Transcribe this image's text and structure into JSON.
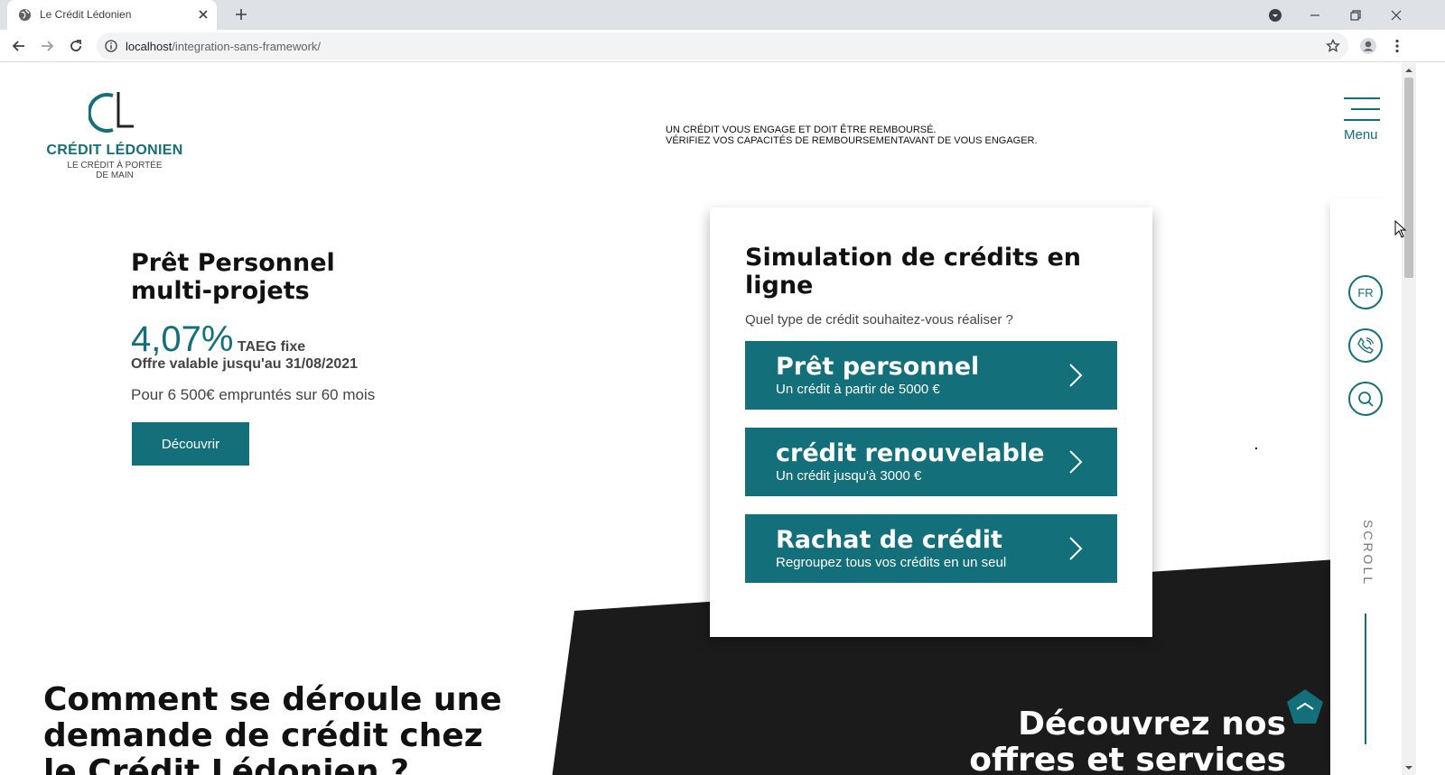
{
  "browser": {
    "tab_title": "Le Crédit Lédonien",
    "url_host": "localhost",
    "url_path": "/integration-sans-framework/"
  },
  "header": {
    "logo_name": "CRÉDIT LÉDONIEN",
    "logo_tagline_1": "LE CRÉDIT À PORTÉE",
    "logo_tagline_2": "DE MAIN",
    "legal_line_1": "UN CRÉDIT VOUS ENGAGE ET DOIT ÊTRE REMBOURSÉ.",
    "legal_line_2": "VÉRIFIEZ VOS CAPACITÉS DE REMBOURSEMENTAVANT DE VOUS ENGAGER.",
    "menu_label": "Menu"
  },
  "hero": {
    "title": "Prêt Personnel multi-projets",
    "rate": "4,07%",
    "rate_suffix": "TAEG fixe",
    "offer_valid": "Offre valable jusqu'au 31/08/2021",
    "offer_detail": "Pour 6 500€ empruntés sur 60 mois",
    "button": "Découvrir"
  },
  "simulator": {
    "title": "Simulation de crédits en ligne",
    "question": "Quel type de crédit souhaitez-vous réaliser ?",
    "options": [
      {
        "title": "Prêt personnel",
        "subtitle": "Un crédit à partir de 5000 €"
      },
      {
        "title": "crédit renouvelable",
        "subtitle": "Un crédit jusqu'à 3000 €"
      },
      {
        "title": "Rachat de crédit",
        "subtitle": "Regroupez tous vos crédits en un seul"
      }
    ]
  },
  "side_rail": {
    "language": "FR",
    "scroll_label": "SCROLL"
  },
  "sections": {
    "process_title": "Comment se déroule une demande de crédit chez le Crédit Lédonien ?",
    "offers_title": "Découvrez nos offres et services"
  },
  "colors": {
    "brand": "#136f7a",
    "dark": "#1b1b1b"
  }
}
